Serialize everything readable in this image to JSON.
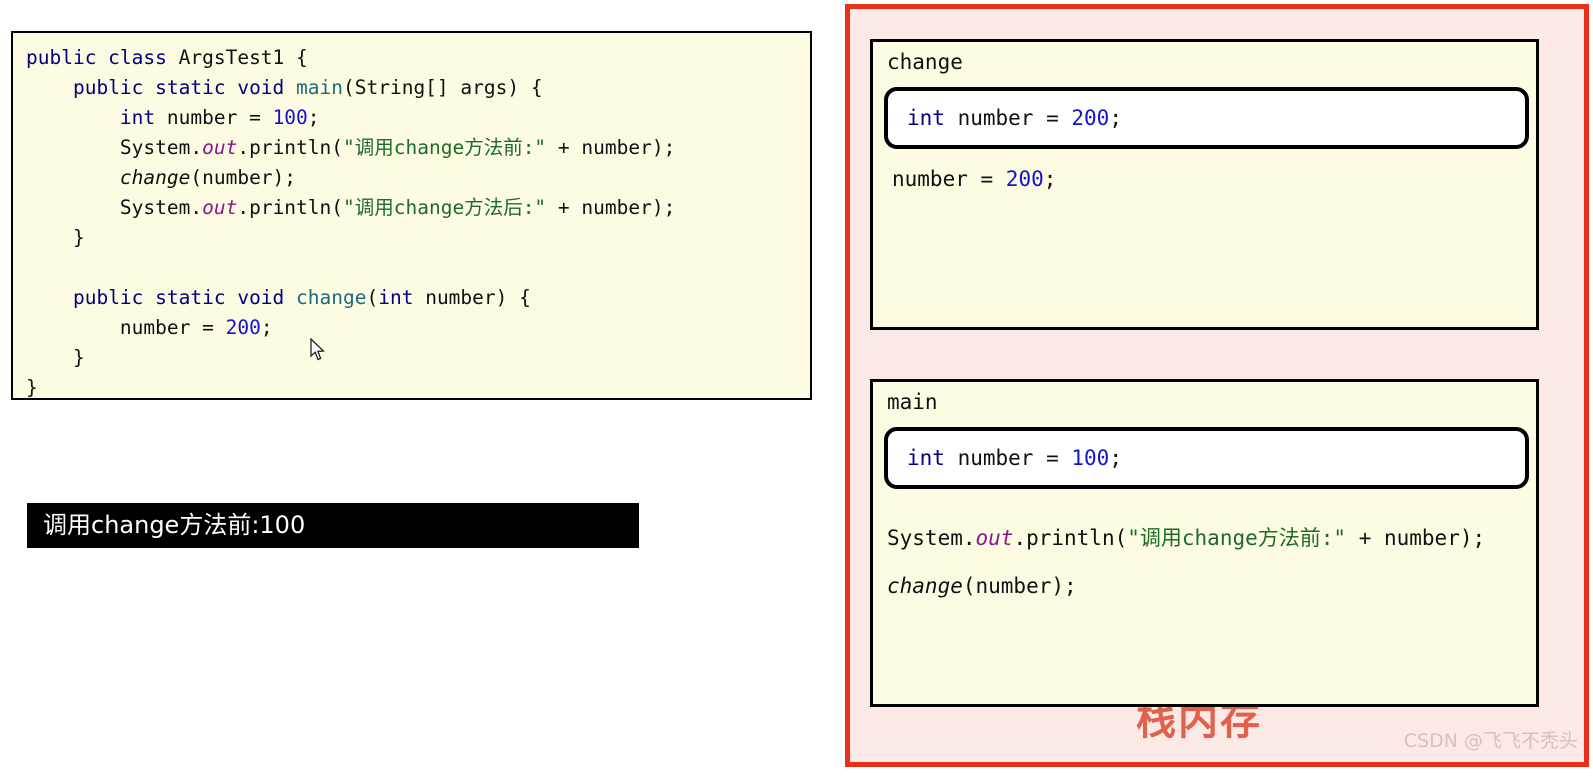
{
  "editor": {
    "background_color": "#fdfbe2",
    "lines": [
      [
        {
          "t": "public class ",
          "c": "kw"
        },
        {
          "t": "ArgsTest1 {",
          "c": "cls"
        }
      ],
      [
        {
          "t": "    ",
          "c": "plain"
        },
        {
          "t": "public static void ",
          "c": "kw"
        },
        {
          "t": "main",
          "c": "mth"
        },
        {
          "t": "(String[] args) {",
          "c": "plain"
        }
      ],
      [
        {
          "t": "        ",
          "c": "plain"
        },
        {
          "t": "int ",
          "c": "kw"
        },
        {
          "t": "number = ",
          "c": "plain"
        },
        {
          "t": "100",
          "c": "num"
        },
        {
          "t": ";",
          "c": "plain"
        }
      ],
      [
        {
          "t": "        System.",
          "c": "plain"
        },
        {
          "t": "out",
          "c": "fld"
        },
        {
          "t": ".println(",
          "c": "plain"
        },
        {
          "t": "\"调用change方法前:\"",
          "c": "str"
        },
        {
          "t": " + number);",
          "c": "plain"
        }
      ],
      [
        {
          "t": "        ",
          "c": "plain"
        },
        {
          "t": "change",
          "c": "itm"
        },
        {
          "t": "(number);",
          "c": "plain"
        }
      ],
      [
        {
          "t": "        System.",
          "c": "plain"
        },
        {
          "t": "out",
          "c": "fld"
        },
        {
          "t": ".println(",
          "c": "plain"
        },
        {
          "t": "\"调用change方法后:\"",
          "c": "str"
        },
        {
          "t": " + number);",
          "c": "plain"
        }
      ],
      [
        {
          "t": "    }",
          "c": "plain"
        }
      ],
      [
        {
          "t": "",
          "c": "plain"
        }
      ],
      [
        {
          "t": "    ",
          "c": "plain"
        },
        {
          "t": "public static void ",
          "c": "kw"
        },
        {
          "t": "change",
          "c": "mth"
        },
        {
          "t": "(",
          "c": "plain"
        },
        {
          "t": "int ",
          "c": "kw"
        },
        {
          "t": "number) {",
          "c": "plain"
        }
      ],
      [
        {
          "t": "        number = ",
          "c": "plain"
        },
        {
          "t": "200",
          "c": "num"
        },
        {
          "t": ";",
          "c": "plain"
        }
      ],
      [
        {
          "t": "    }",
          "c": "plain"
        }
      ],
      [
        {
          "t": "}",
          "c": "plain"
        }
      ]
    ]
  },
  "console": {
    "text": "调用change方法前:100",
    "background_color": "#000000",
    "text_color": "#ffffff"
  },
  "stack_panel": {
    "border_color": "#e8311a",
    "background_color": "#fce9e6",
    "stack_label": "栈内存",
    "stack_label_color": "#e0624c",
    "watermark": "CSDN @飞飞不秃头",
    "frames": [
      {
        "label": "change",
        "variable_box": [
          {
            "t": "int ",
            "c": "kw"
          },
          {
            "t": "number = ",
            "c": "plain"
          },
          {
            "t": "200",
            "c": "num"
          },
          {
            "t": ";",
            "c": "plain"
          }
        ],
        "statements": [
          [
            {
              "t": "number = ",
              "c": "plain"
            },
            {
              "t": "200",
              "c": "num"
            },
            {
              "t": ";",
              "c": "plain"
            }
          ]
        ]
      },
      {
        "label": "main",
        "variable_box": [
          {
            "t": "int ",
            "c": "kw"
          },
          {
            "t": "number = ",
            "c": "plain"
          },
          {
            "t": "100",
            "c": "num"
          },
          {
            "t": ";",
            "c": "plain"
          }
        ],
        "statements": [
          [
            {
              "t": "System.",
              "c": "plain"
            },
            {
              "t": "out",
              "c": "fld"
            },
            {
              "t": ".println(",
              "c": "plain"
            },
            {
              "t": "\"调用change方法前:\"",
              "c": "str"
            },
            {
              "t": " + number);",
              "c": "plain"
            }
          ],
          [
            {
              "t": "change",
              "c": "itm"
            },
            {
              "t": "(number);",
              "c": "plain"
            }
          ]
        ]
      }
    ]
  }
}
